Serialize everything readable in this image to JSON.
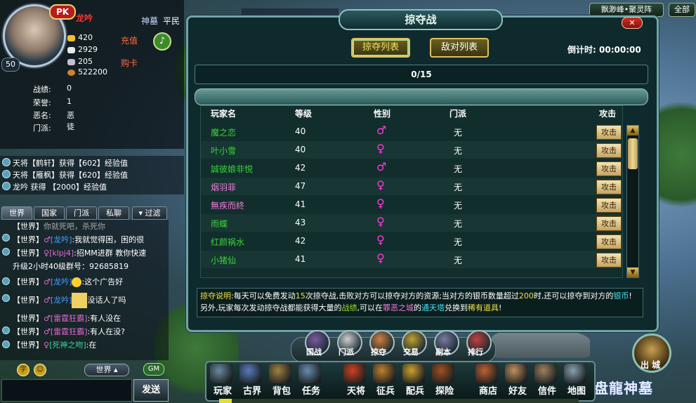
{
  "player": {
    "pk": "PK",
    "name": "龙吟",
    "level": "50",
    "server_tag": "神墓",
    "rank": "平民",
    "resources": [
      "420",
      "2929",
      "205",
      "522200"
    ],
    "recharge_label": "充值",
    "buy_card_label": "购卡",
    "stats": [
      {
        "label": "战绩:",
        "value": "0"
      },
      {
        "label": "荣誉:",
        "value": "1"
      },
      {
        "label": "恶名:",
        "value": "恶徒"
      },
      {
        "label": "门派:",
        "value": ""
      }
    ]
  },
  "top_right": {
    "location": "飘渺峰•聚灵阵",
    "all_label": "全部"
  },
  "background_notice": "",
  "system_messages": [
    "天将【鹤轩】获得【602】经验值",
    "天将【雁枫】获得【620】经验值",
    "龙吟 获得 【2000】经验值"
  ],
  "chat_tabs": [
    "世界",
    "国家",
    "门派",
    "私聊",
    "过滤"
  ],
  "chat": [
    {
      "ch": "【世界】",
      "name": "",
      "text": "你就死吧，杀死你"
    },
    {
      "ch": "【世界】",
      "name": "[龙吟]",
      "text": ":我就觉得困，困的很"
    },
    {
      "ch": "【世界】",
      "name": "[klpj4]",
      "text": ":招MM进群 教你快速"
    },
    {
      "ch": "",
      "name": "",
      "text": "升级2小时40级群号：92685819"
    },
    {
      "ch": "【世界】",
      "name": "[龙吟]",
      "text": ":这个广告好"
    },
    {
      "ch": "【世界】",
      "name": "[龙吟]",
      "text": "没话人了吗"
    },
    {
      "ch": "【世界】",
      "name": "[雷霆狂霸]",
      "text": ":有人没在"
    },
    {
      "ch": "【世界】",
      "name": "[雷霆狂霸]",
      "text": ":有人在没?"
    },
    {
      "ch": "【世界】",
      "name": "[死神之吻]",
      "text": ":在"
    }
  ],
  "chat_controls": {
    "world_select": "世界",
    "gm": "GM",
    "send": "发送"
  },
  "dialog": {
    "title": "掠夺战",
    "close": "✕",
    "tab_plunder": "掠夺列表",
    "tab_enemy": "敌对列表",
    "countdown_label": "倒计时:",
    "countdown": "00:00:00",
    "count": "0/15",
    "headers": [
      "玩家名",
      "等级",
      "性别",
      "门派",
      "攻击"
    ],
    "rows": [
      {
        "name": "魔之恋",
        "level": "40",
        "gender": "♂",
        "sect": "无",
        "name_color": "green"
      },
      {
        "name": "叶小雪",
        "level": "40",
        "gender": "♀",
        "sect": "无",
        "name_color": "green"
      },
      {
        "name": "誠彼娘非悦",
        "level": "42",
        "gender": "♂",
        "sect": "无",
        "name_color": "green"
      },
      {
        "name": "烟羽菲",
        "level": "47",
        "gender": "♀",
        "sect": "无",
        "name_color": "pink"
      },
      {
        "name": "無疾而終",
        "level": "41",
        "gender": "♀",
        "sect": "无",
        "name_color": "pink"
      },
      {
        "name": "雨蝶",
        "level": "43",
        "gender": "♀",
        "sect": "无",
        "name_color": "green"
      },
      {
        "name": "红颜祸水",
        "level": "42",
        "gender": "♀",
        "sect": "无",
        "name_color": "green"
      },
      {
        "name": "小猪仙",
        "level": "41",
        "gender": "♀",
        "sect": "无",
        "name_color": "green"
      }
    ],
    "attack_label": "攻击",
    "explain": {
      "title": "掠夺说明",
      "p1": ":每天可以免费发动",
      "n1": "15",
      "p2": "次掠夺战,击败对方可以掠夺对方的资源;当对方的银币数量超过",
      "n2": "200",
      "p3": "时,还可以掠夺到对方的",
      "w1": "银币",
      "p4": "! 另外,玩家每次发动掠夺战都能获得大量的",
      "w2": "战绩",
      "p5": ",可以在",
      "w3": "罪恶之城",
      "p6": "的",
      "w4": "通天塔",
      "p7": "兑换到",
      "w5": "稀有道具",
      "p8": "!"
    }
  },
  "ring_menu": [
    "国战",
    "门派",
    "掠夺",
    "交易",
    "副本",
    "排行"
  ],
  "exit_city": "出 城",
  "logo": "盘龍神墓",
  "bottom_menu": [
    "玩家",
    "古界",
    "背包",
    "任务",
    "天将",
    "征兵",
    "配兵",
    "探险",
    "商店",
    "好友",
    "信件",
    "地图"
  ],
  "colors": {
    "accent": "#6fa4a8",
    "green_name": "#3ad23a",
    "pink_name": "#f07ad8",
    "gender": "#ff3ad8"
  }
}
